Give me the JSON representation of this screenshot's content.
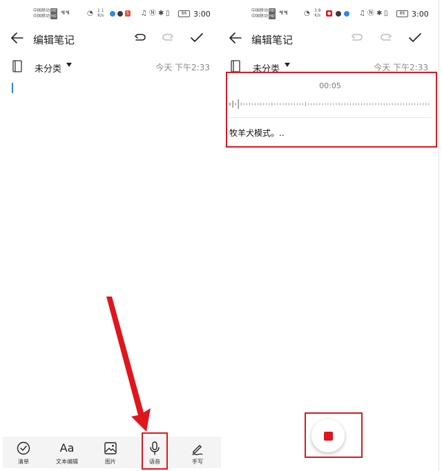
{
  "status_bar": {
    "carrier_left": [
      "中国移动",
      "中国移动"
    ],
    "carrier_tag": "HD",
    "speed_left": "1.1\nK/s",
    "speed_right": "3.8\nK/s",
    "battery": "86",
    "time": "3:00"
  },
  "header": {
    "title": "编辑笔记",
    "back_icon": "arrow-left-icon",
    "undo_icon": "undo-icon",
    "redo_icon": "redo-icon",
    "confirm_icon": "check-icon"
  },
  "meta": {
    "category": "未分类",
    "timestamp": "今天 下午2:33"
  },
  "toolbar": {
    "items": [
      {
        "icon": "checklist-icon",
        "label": "清单"
      },
      {
        "icon": "text-format-icon",
        "glyph": "Aa",
        "label": "文本编辑"
      },
      {
        "icon": "image-icon",
        "label": "图片"
      },
      {
        "icon": "microphone-icon",
        "label": "语音"
      },
      {
        "icon": "handwriting-icon",
        "label": "手写"
      }
    ]
  },
  "recording": {
    "elapsed": "00:05",
    "transcript": "牧羊犬模式。.."
  },
  "colors": {
    "highlight": "#e0161d",
    "accent_cursor": "#2a7ef0",
    "toolbar_bg": "#f4f4f4"
  }
}
